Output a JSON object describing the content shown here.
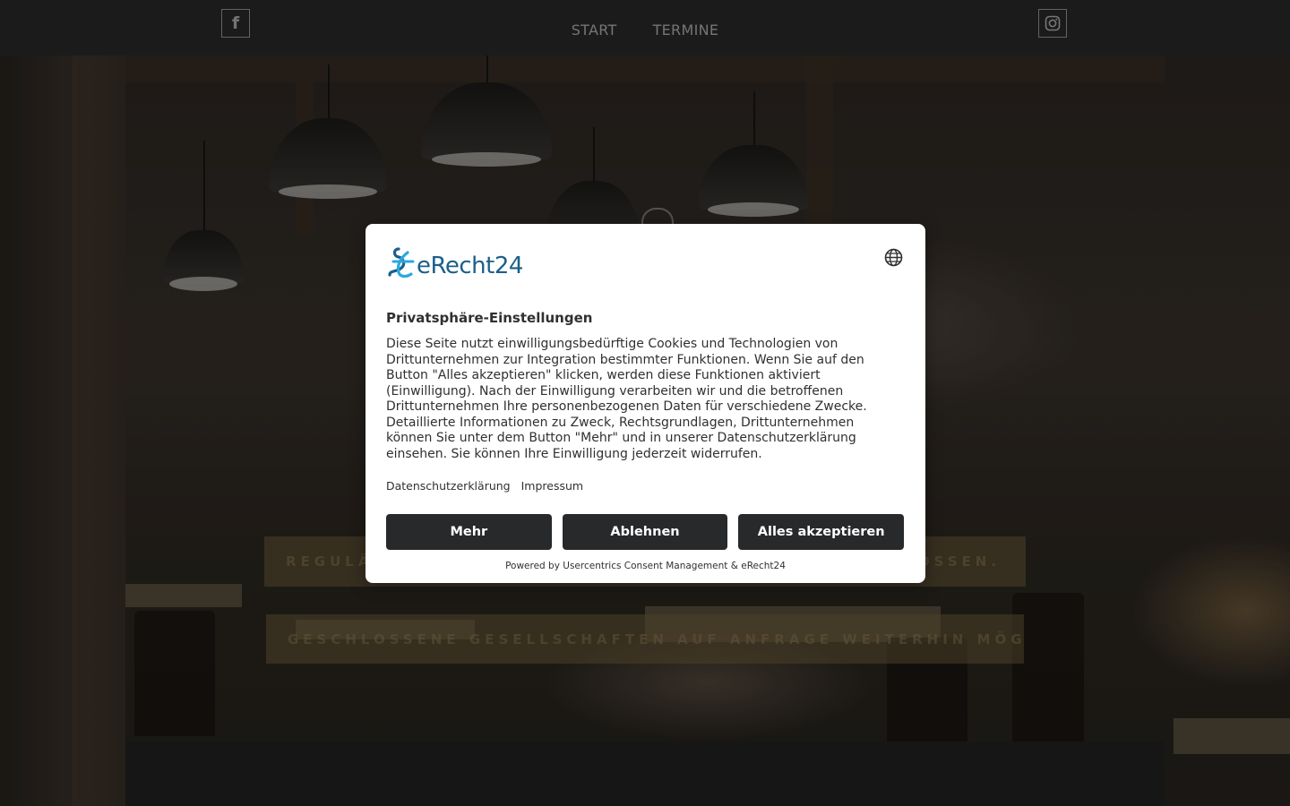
{
  "nav": {
    "items": [
      {
        "label": "START"
      },
      {
        "label": "TERMINE"
      }
    ],
    "facebook_icon": "facebook-icon",
    "instagram_icon": "instagram-icon"
  },
  "hero": {
    "banner_1_left": "REGULÄ",
    "banner_1_right": "OSSEN.",
    "banner_2": "GESCHLOSSENE GESELLSCHAFTEN AUF ANFRAGE WEITERHIN MÖGLICH!"
  },
  "consent": {
    "brand_name": "eRecht24",
    "title": "Privatsphäre-Einstellungen",
    "body": "Diese Seite nutzt einwilligungsbedürftige Cookies und Technologien von Drittunternehmen zur Integration bestimmter Funktionen. Wenn Sie auf den Button \"Alles akzeptieren\" klicken, werden diese Funktionen aktiviert (Einwilligung). Nach der Einwilligung verarbeiten wir und die betroffenen Drittunternehmen Ihre personenbezogenen Daten für verschiedene Zwecke. Detaillierte Informationen zu Zweck, Rechtsgrundlagen, Drittunternehmen können Sie unter dem Button \"Mehr\" und in unserer Datenschutzerklärung einsehen. Sie können Ihre Einwilligung jederzeit widerrufen.",
    "links": {
      "privacy": "Datenschutzerklärung",
      "imprint": "Impressum"
    },
    "buttons": {
      "more": "Mehr",
      "decline": "Ablehnen",
      "accept_all": "Alles akzeptieren"
    },
    "powered_by": "Powered by Usercentrics Consent Management & eRecht24",
    "language_icon": "globe-icon",
    "colors": {
      "brand_blue": "#1b5f8a",
      "brand_light_blue": "#2aa9e0",
      "button_bg": "#27292b"
    }
  }
}
